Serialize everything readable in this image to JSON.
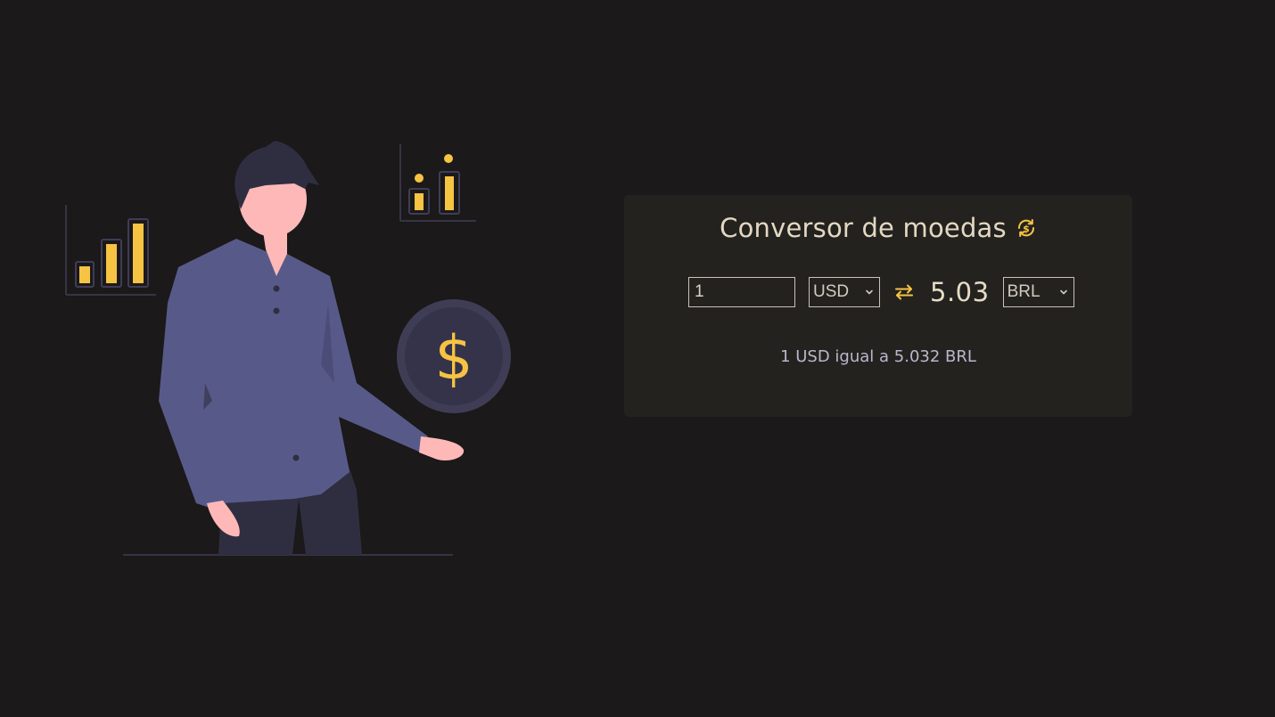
{
  "converter": {
    "title": "Conversor de moedas",
    "title_icon": "currency-exchange-icon",
    "amount_value": "1",
    "from_currency": "USD",
    "to_currency": "BRL",
    "swap_icon": "swap-arrows-icon",
    "result": "5.03",
    "rate_text": "1 USD igual a 5.032 BRL"
  },
  "illustration": {
    "coin_symbol": "$"
  },
  "colors": {
    "background": "#1b1919",
    "card": "#24221f",
    "accent": "#f6c343",
    "shirt": "#575a89",
    "title_text": "#e3d8c2",
    "rate_text": "#b9b7cc"
  }
}
